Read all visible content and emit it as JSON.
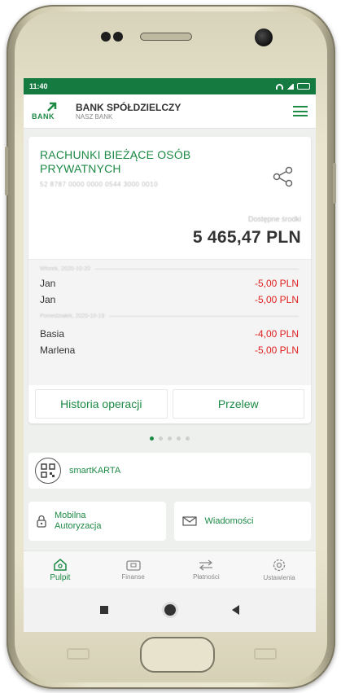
{
  "status_bar": {
    "time": "11:40"
  },
  "header": {
    "bank_title": "BANK SPÓŁDZIELCZY",
    "bank_subtitle": "NASZ BANK",
    "logo_text": "BANK"
  },
  "account": {
    "title": "RACHUNKI BIEŻĄCE OSÓB PRYWATNYCH",
    "number": "52 8787 0000 0000 0544 3000 0010",
    "available_label": "Dostępne środki",
    "balance": "5 465,47 PLN"
  },
  "transaction_groups": [
    {
      "date": "Wtorek, 2020-10-20",
      "items": [
        {
          "name": "Jan",
          "amount": "-5,00 PLN"
        },
        {
          "name": "Jan",
          "amount": "-5,00 PLN"
        }
      ]
    },
    {
      "date": "Poniedziałek, 2020-10-19",
      "items": [
        {
          "name": "Basia",
          "amount": "-4,00 PLN"
        },
        {
          "name": "Marlena",
          "amount": "-5,00 PLN"
        }
      ]
    }
  ],
  "actions": {
    "history": "Historia operacji",
    "transfer": "Przelew"
  },
  "smartkarta": {
    "label": "smartKARTA"
  },
  "tiles": {
    "mobile_auth": "Mobilna Autoryzacja",
    "messages": "Wiadomości"
  },
  "nav": [
    {
      "label": "Pulpit",
      "icon": "home-icon",
      "active": true
    },
    {
      "label": "Finanse",
      "icon": "wallet-icon"
    },
    {
      "label": "Płatności",
      "icon": "transfer-arrows-icon"
    },
    {
      "label": "Ustawienia",
      "icon": "gear-icon"
    }
  ],
  "colors": {
    "brand": "#1d8a45",
    "status_bar": "#157a3f",
    "negative": "#e02020"
  }
}
